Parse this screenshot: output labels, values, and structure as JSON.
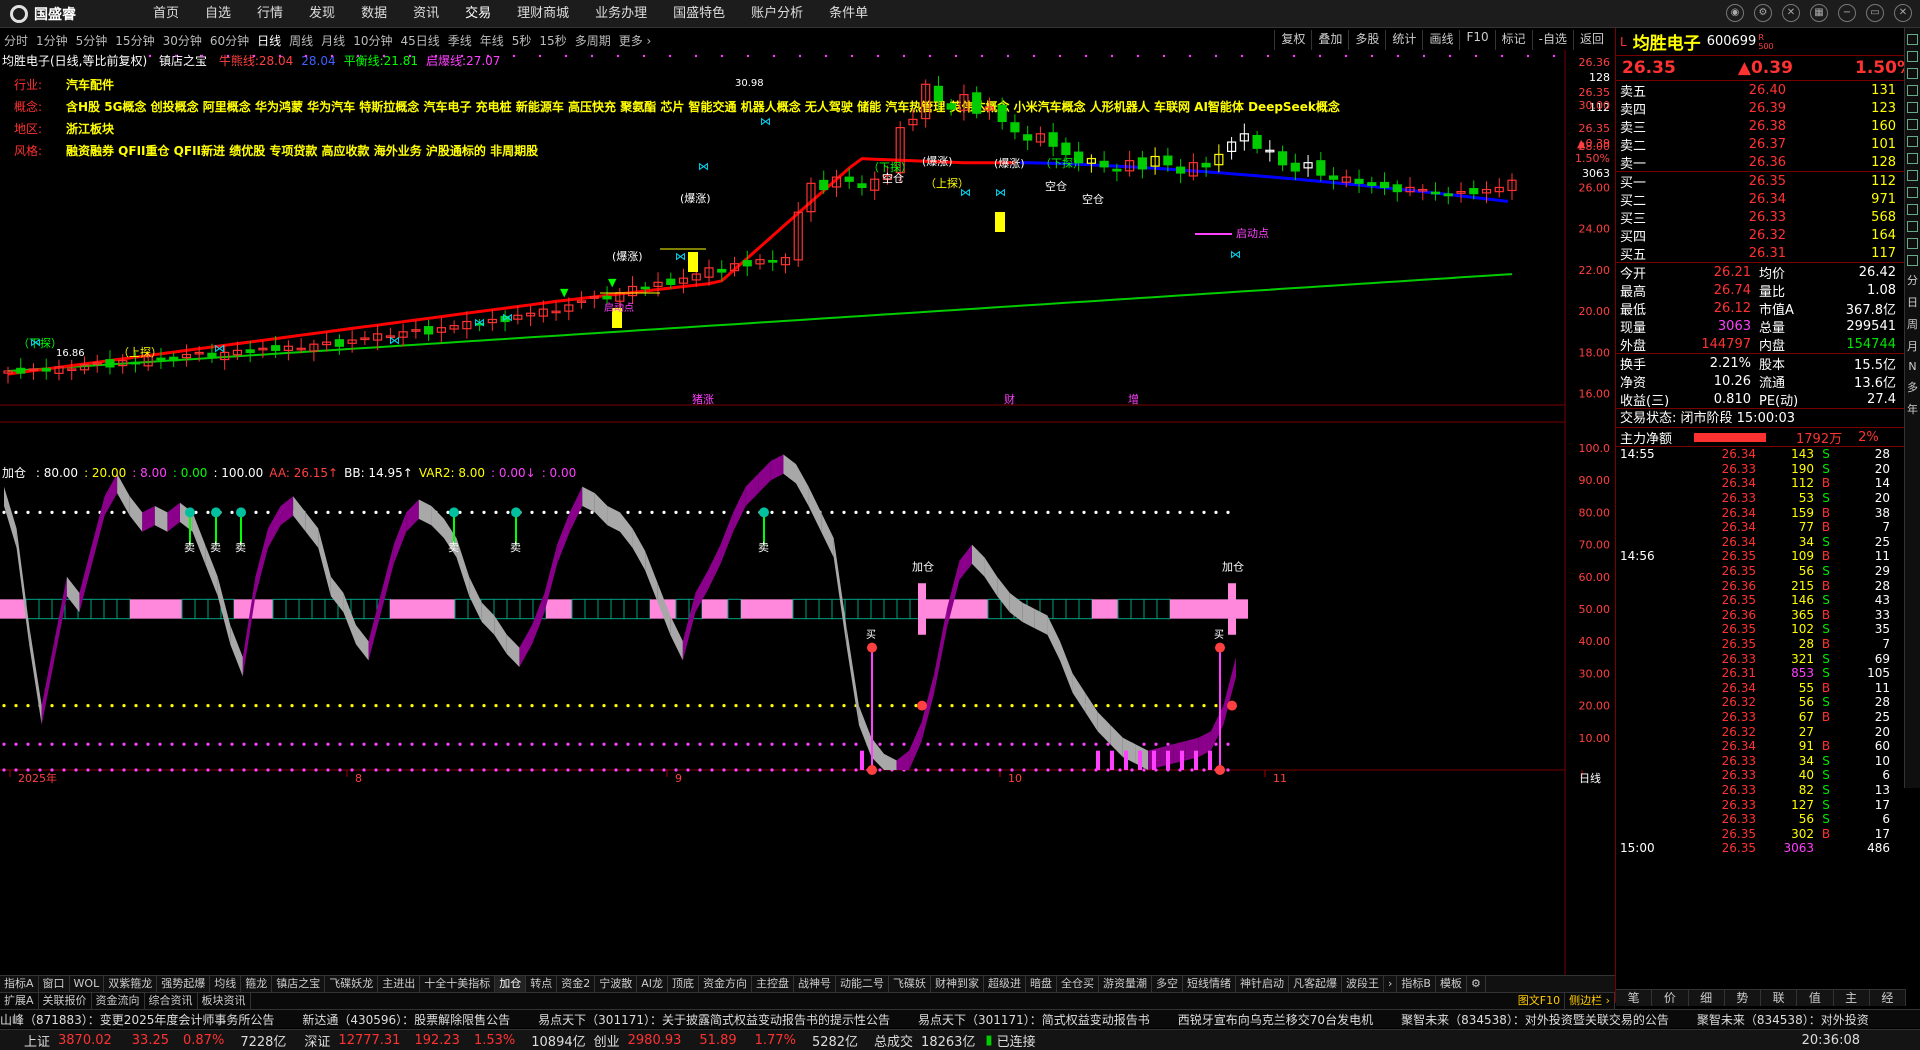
{
  "app": {
    "logo_text": "国盛睿"
  },
  "menu": [
    "首页",
    "自选",
    "行情",
    "发现",
    "数据",
    "资讯",
    "交易",
    "理财商城",
    "业务办理",
    "国盛特色",
    "账户分析",
    "条件单"
  ],
  "periods": [
    "分时",
    "1分钟",
    "5分钟",
    "15分钟",
    "30分钟",
    "60分钟",
    "日线",
    "周线",
    "月线",
    "10分钟",
    "45日线",
    "季线",
    "年线",
    "5秒",
    "15秒",
    "多周期",
    "更多 ›"
  ],
  "active_period": "日线",
  "tools": [
    "复权",
    "叠加",
    "多股",
    "统计",
    "画线",
    "F10",
    "标记",
    "-自选",
    "返回"
  ],
  "kline_header": {
    "name": "均胜电子(日线,等比前复权)",
    "tool": "镇店之宝",
    "items": [
      {
        "label": "牛熊线:",
        "value": "28.04",
        "color": "#ff4040"
      },
      {
        "label": "",
        "value": "28.04",
        "color": "#4060ff"
      },
      {
        "label": "平衡线:",
        "value": "21.81",
        "color": "#00ff00"
      },
      {
        "label": "启爆线:",
        "value": "27.07",
        "color": "#ff40ff"
      }
    ]
  },
  "tags": [
    {
      "label": "行业:",
      "text": "汽车配件"
    },
    {
      "label": "概念:",
      "text": "含H股 5G概念 创投概念 阿里概念 华为鸿蒙 华为汽车 特斯拉概念 汽车电子 充电桩 新能源车 高压快充 聚氨酯 芯片 智能交通 机器人概念 无人驾驶 储能 汽车热管理 英伟达概念 小米汽车概念 人形机器人 车联网 AI智能体 DeepSeek概念"
    },
    {
      "label": "地区:",
      "text": "浙江板块"
    },
    {
      "label": "风格:",
      "text": "融资融券 QFII重仓 QFII新进 绩优股 专项贷款 高应收款 海外业务 沪股通标的 非周期股"
    }
  ],
  "price_axis": [
    "26.36",
    "128",
    "26.35",
    "112",
    "26.35",
    "▲0.39",
    "1.50%",
    "3063",
    "30.00",
    "28.00",
    "26.00",
    "24.00",
    "22.00",
    "20.00",
    "18.00",
    "16.00"
  ],
  "chart_labels": {
    "xia_tan": "（下探）",
    "shang_tan": "（上探）",
    "bao_zhang": "(爆涨)",
    "qi_dong": "启动点",
    "kong_cang": "空仓",
    "high": "30.98",
    "low": "16.86",
    "events": [
      "猪涨",
      "财",
      "增"
    ]
  },
  "ind_header": {
    "name": "加仓",
    "items": [
      {
        "text": ": 80.00",
        "color": "#ffffff"
      },
      {
        "text": ": 20.00",
        "color": "#ffff00"
      },
      {
        "text": ": 8.00",
        "color": "#ff40ff"
      },
      {
        "text": ": 0.00",
        "color": "#00ff00"
      },
      {
        "text": ": 100.00",
        "color": "#ffffff"
      },
      {
        "text": "AA: 26.15↑",
        "color": "#ff4040"
      },
      {
        "text": "BB: 14.95↑",
        "color": "#ffffff"
      },
      {
        "text": "VAR2: 8.00",
        "color": "#ffff00"
      },
      {
        "text": ": 0.00↓",
        "color": "#ff40ff"
      },
      {
        "text": ": 0.00",
        "color": "#ff40ff"
      }
    ]
  },
  "ind_axis": [
    "100.0",
    "90.00",
    "80.00",
    "70.00",
    "60.00",
    "50.00",
    "40.00",
    "30.00",
    "20.00",
    "10.00"
  ],
  "ind_labels": {
    "sell": "卖",
    "buy": "买",
    "add": "加仓"
  },
  "x_axis": [
    "2025年",
    "8",
    "9",
    "10",
    "11",
    "日线"
  ],
  "bottom_tabs": [
    "指标A",
    "窗口",
    "WOL",
    "双紫箍龙",
    "强势起爆",
    "均线",
    "箍龙",
    "镇店之宝",
    "飞碟妖龙",
    "主进出",
    "十全十美指标",
    "加仓",
    "转点",
    "资金2",
    "宁波散",
    "AI龙",
    "顶底",
    "资金方向",
    "主控盘",
    "战神号",
    "动能二号",
    "飞碟妖",
    "财神到家",
    "超级进",
    "暗盘",
    "全仓买",
    "游资量潮",
    "多空",
    "短线情绪",
    "神针启动",
    "凡客起爆",
    "波段王",
    "›",
    "指标B",
    "模板",
    "⚙"
  ],
  "active_tab": "加仓",
  "bottom_tabs2": [
    "扩展A",
    "关联报价",
    "资金流向",
    "综合资讯",
    "板块资讯",
    "图文F10",
    "侧边栏 ›"
  ],
  "rp": {
    "title": "均胜电子",
    "code": "600699",
    "flag": "R",
    "sub": "500",
    "price": "26.35",
    "change": "▲0.39",
    "pct": "1.50%",
    "asks": [
      {
        "n": "卖五",
        "p": "26.40",
        "v": "131"
      },
      {
        "n": "卖四",
        "p": "26.39",
        "v": "123"
      },
      {
        "n": "卖三",
        "p": "26.38",
        "v": "160"
      },
      {
        "n": "卖二",
        "p": "26.37",
        "v": "101"
      },
      {
        "n": "卖一",
        "p": "26.36",
        "v": "128"
      }
    ],
    "bids": [
      {
        "n": "买一",
        "p": "26.35",
        "v": "112"
      },
      {
        "n": "买二",
        "p": "26.34",
        "v": "971"
      },
      {
        "n": "买三",
        "p": "26.33",
        "v": "568"
      },
      {
        "n": "买四",
        "p": "26.32",
        "v": "164"
      },
      {
        "n": "买五",
        "p": "26.31",
        "v": "117"
      }
    ],
    "stats": [
      [
        "今开",
        "26.21",
        "均价",
        "26.42"
      ],
      [
        "最高",
        "26.74",
        "量比",
        "1.08"
      ],
      [
        "最低",
        "26.12",
        "市值A",
        "367.8亿"
      ],
      [
        "现量",
        "3063",
        "总量",
        "299541"
      ],
      [
        "外盘",
        "144797",
        "内盘",
        "154744"
      ]
    ],
    "stats2": [
      [
        "换手",
        "2.21%",
        "股本",
        "15.5亿"
      ],
      [
        "净资",
        "10.26",
        "流通",
        "13.6亿"
      ],
      [
        "收益(三)",
        "0.810",
        "PE(动)",
        "27.4"
      ]
    ],
    "trade_state": "交易状态: 闭市阶段 15:00:03",
    "flow_label": "主力净额",
    "flow_value": "1792万",
    "flow_pct": "2%",
    "ticks_time1": "14:55",
    "ticks_time2": "14:56",
    "ticks_time3": "15:00",
    "ticks": [
      [
        "26.34",
        "143",
        "S",
        "28"
      ],
      [
        "26.33",
        "190",
        "S",
        "20"
      ],
      [
        "26.34",
        "112",
        "B",
        "14"
      ],
      [
        "26.33",
        "53",
        "S",
        "20"
      ],
      [
        "26.34",
        "159",
        "B",
        "38"
      ],
      [
        "26.34",
        "77",
        "B",
        "7"
      ],
      [
        "26.34",
        "34",
        "S",
        "25"
      ],
      [
        "26.35",
        "109",
        "B",
        "11"
      ],
      [
        "26.35",
        "56",
        "S",
        "29"
      ],
      [
        "26.36",
        "215",
        "B",
        "28"
      ],
      [
        "26.35",
        "146",
        "S",
        "43"
      ],
      [
        "26.36",
        "365",
        "B",
        "33"
      ],
      [
        "26.35",
        "102",
        "S",
        "35"
      ],
      [
        "26.35",
        "28",
        "B",
        "7"
      ],
      [
        "26.33",
        "321",
        "S",
        "69"
      ],
      [
        "26.31",
        "853",
        "S",
        "105"
      ],
      [
        "26.34",
        "55",
        "B",
        "11"
      ],
      [
        "26.32",
        "56",
        "S",
        "28"
      ],
      [
        "26.33",
        "67",
        "B",
        "25"
      ],
      [
        "26.32",
        "27",
        "",
        "20"
      ],
      [
        "26.34",
        "91",
        "B",
        "60"
      ],
      [
        "26.33",
        "34",
        "S",
        "10"
      ],
      [
        "26.33",
        "40",
        "S",
        "6"
      ],
      [
        "26.33",
        "82",
        "S",
        "13"
      ],
      [
        "26.33",
        "127",
        "S",
        "17"
      ],
      [
        "26.33",
        "56",
        "S",
        "6"
      ],
      [
        "26.35",
        "302",
        "B",
        "17"
      ],
      [
        "26.35",
        "3063",
        "",
        "486"
      ]
    ],
    "bottom_tabs": [
      "笔",
      "价",
      "细",
      "势",
      "联",
      "值",
      "主",
      "经"
    ],
    "side_icons": [
      "分",
      "日",
      "周",
      "月",
      "N",
      "多",
      "年"
    ]
  },
  "news": [
    "山峰（871883）：变更2025年度会计师事务所公告",
    "新达通（430596）：股票解除限售公告",
    "易点天下（301171）：关于披露简式权益变动报告书的提示性公告",
    "易点天下（301171）：简式权益变动报告书",
    "西锐牙宣布向乌克兰移交70台发电机",
    "聚智未来（834538）：对外投资暨关联交易的公告",
    "聚智未来（834538）：对外投资"
  ],
  "status": {
    "sh_label": "上证",
    "sh": "3870.02",
    "sh_chg": "33.25",
    "sh_pct": "0.87%",
    "sh_amt": "7228亿",
    "sz_label": "深证",
    "sz": "12777.31",
    "sz_chg": "192.23",
    "sz_pct": "1.53%",
    "sz_amt": "10894亿",
    "cy_label": "创业",
    "cy": "2980.93",
    "cy_chg": "51.89",
    "cy_pct": "1.77%",
    "cy_amt": "5282亿",
    "total_label": "总成交",
    "total": "18263亿",
    "conn": "已连接",
    "time": "20:36:08"
  },
  "colors": {
    "up": "#ff3232",
    "down": "#00e600",
    "bull": "#ff0000",
    "avg": "#0000ff",
    "balance": "#00cc00",
    "ind_pink": "#ff88dd",
    "ind_purple": "#8b008b"
  }
}
